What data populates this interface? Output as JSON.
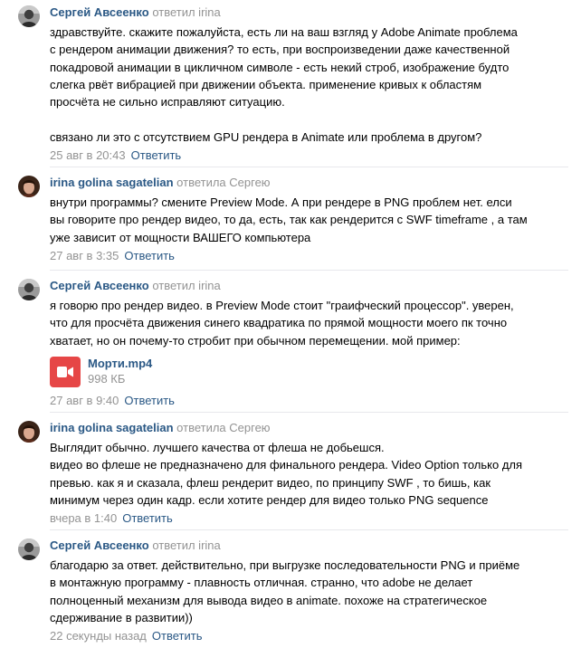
{
  "reply_label": "Ответить",
  "comments": [
    {
      "author": "Сергей Авсеенко",
      "replied": "ответил irina",
      "avatar": "avatar-sergey",
      "text": "здравствуйте. скажите пожалуйста, есть ли на ваш взгляд у Adobe Animate проблема\nс рендером анимации движения? то есть, при воспроизведении даже качественной\nпокадровой анимации в цикличном символе - есть некий строб, изображение будто\nслегка рвёт вибрацией при движении объекта. применение кривых к областям\nпросчёта не сильно исправляют ситуацию.\n\nсвязано ли это с отсутствием GPU рендера в Animate или проблема в другом?",
      "date": "25 авг в 20:43"
    },
    {
      "author": "irina golina sagatelian",
      "replied": "ответила Сергею",
      "avatar": "avatar-irina",
      "text": "внутри программы? смените Preview Mode. А при рендере в PNG проблем нет. елси\nвы говорите про рендер видео, то да, есть, так как рендерится с SWF timeframe , а там\nуже зависит от мощности ВАШЕГО компьютера",
      "date": "27 авг в 3:35"
    },
    {
      "author": "Сергей Авсеенко",
      "replied": "ответил irina",
      "avatar": "avatar-sergey",
      "text": "я говорю про рендер видео. в Preview Mode стоит \"граифческий процессор\". уверен,\nчто для просчёта движения синего квадратика по прямой мощности моего пк точно\nхватает, но он почему-то стробит при обычном перемещении. мой пример:",
      "attachment": {
        "name": "Морти.mp4",
        "size": "998 КБ",
        "icon": "video-file-icon"
      },
      "date": "27 авг в 9:40"
    },
    {
      "author": "irina golina sagatelian",
      "replied": "ответила Сергею",
      "avatar": "avatar-irina",
      "text": "Выглядит обычно. лучшего качества от флеша не добьешся.\nвидео во флеше не предназначено для финального рендера. Video Option только для\nпревью. как я и сказала, флеш рендерит видео, по принципу SWF , то бишь, как\nминимум через один кадр. если хотите рендер для видео только PNG sequence",
      "date": "вчера в 1:40"
    },
    {
      "author": "Сергей Авсеенко",
      "replied": "ответил irina",
      "avatar": "avatar-sergey",
      "text": "благодарю за ответ. действительно, при выгрузке последовательности PNG и приёме\nв монтажную программу - плавность отличная. странно, что adobe не делает\nполноценный механизм для вывода видео в animate. похоже на стратегическое\nсдерживание в развитии))",
      "date": "22 секунды назад"
    }
  ]
}
